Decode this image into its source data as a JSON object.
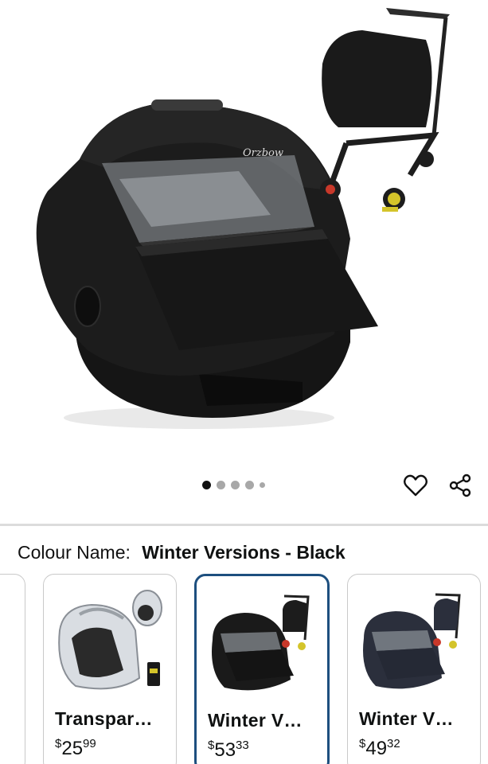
{
  "product": {
    "brand_logo_text": "Orzbow",
    "carousel": {
      "image_count": 5,
      "active_index": 0
    }
  },
  "actions": {
    "wishlist_icon": "heart-outline-icon",
    "share_icon": "share-icon"
  },
  "colour": {
    "label": "Colour Name:",
    "selected_value": "Winter Versions - Black"
  },
  "swatches": [
    {
      "title": "Transpar…",
      "currency": "$",
      "whole": "25",
      "fraction": "99",
      "selected": false
    },
    {
      "title": "Winter V…",
      "currency": "$",
      "whole": "53",
      "fraction": "33",
      "selected": true
    },
    {
      "title": "Winter V…",
      "currency": "$",
      "whole": "49",
      "fraction": "32",
      "selected": false
    }
  ],
  "colors": {
    "selected_border": "#1d4f7f",
    "cover_black": "#1a1a1a",
    "cover_navy": "#2b2f3c",
    "dot_active": "#111111",
    "dot_inactive": "#a8a8a8"
  }
}
